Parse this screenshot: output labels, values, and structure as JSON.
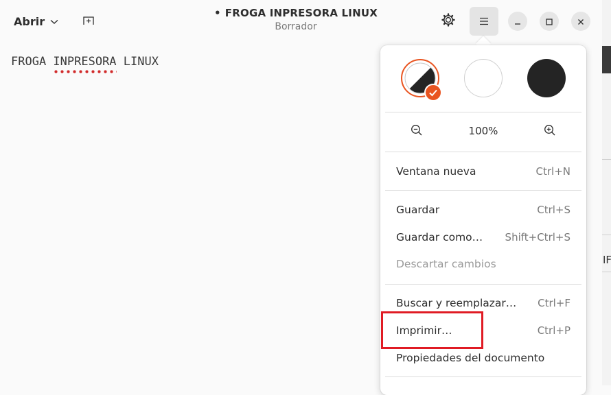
{
  "header": {
    "open_label": "Abrir",
    "title": "FROGA INPRESORA LINUX",
    "modified_marker": "•",
    "subtitle": "Borrador"
  },
  "editor": {
    "line_before": "FROGA ",
    "misspelled_word": "INPRESORA",
    "line_after": " LINUX"
  },
  "menu": {
    "style_schemes": [
      "follow-system",
      "light",
      "dark"
    ],
    "selected_style": "follow-system",
    "zoom_level": "100%",
    "items": [
      {
        "label": "Ventana nueva",
        "accel": "Ctrl+N",
        "enabled": true
      },
      {
        "label": "Guardar",
        "accel": "Ctrl+S",
        "enabled": true
      },
      {
        "label": "Guardar como…",
        "accel": "Shift+Ctrl+S",
        "enabled": true
      },
      {
        "label": "Descartar cambios",
        "accel": "",
        "enabled": false
      },
      {
        "label": "Buscar y reemplazar…",
        "accel": "Ctrl+F",
        "enabled": true
      },
      {
        "label": "Imprimir…",
        "accel": "Ctrl+P",
        "enabled": true
      },
      {
        "label": "Propiedades del documento",
        "accel": "",
        "enabled": true
      }
    ]
  },
  "background_fragment": "IF",
  "colors": {
    "accent": "#e95420",
    "annotation": "#e01b24",
    "spellcheck": "#d12a2a"
  }
}
